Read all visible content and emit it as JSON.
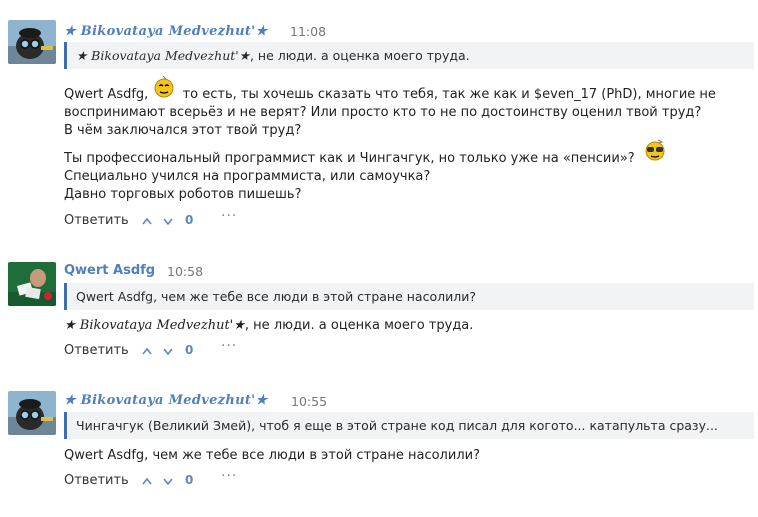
{
  "colors": {
    "author": "#4f7fbf",
    "quote_bar": "#3f6fa8",
    "quote_bg": "#f2f3f5",
    "vote": "#5b86c5"
  },
  "comments": [
    {
      "author": "★ Bikovataya Medvezhut'★",
      "time": "11:08",
      "quote_name": "★ Bikovataya Medvezhut'★",
      "quote_text": ", не люди. а оценка моего труда.",
      "p1_name": "Qwert Asdfg,",
      "p1_l1": "то есть, ты хочешь сказать что тебя, так же как и $even_17 (PhD), многие не",
      "p1_l2": "воспринимают всерьёз и не верят? Или просто кто то не по достоинству оценил твой труд?",
      "p1_l3": "В чём заключался этот твой труд?",
      "p2_l1": "Ты профессиональный программист как и Чингачгук, но только уже на «пенсии»?",
      "p2_l2": "Специально учился на программиста, или самоучка?",
      "p2_l3": "Давно торговых роботов пишешь?",
      "reply": "Ответить",
      "votes": "0",
      "more": "···"
    },
    {
      "author": "Qwert Asdfg",
      "time": "10:58",
      "quote_text": "Qwert Asdfg, чем же тебе все люди в этой стране насолили?",
      "body_name": "★ Bikovataya Medvezhut'★",
      "body_text": ", не люди. а оценка моего труда.",
      "reply": "Ответить",
      "votes": "0",
      "more": "···"
    },
    {
      "author": "★ Bikovataya Medvezhut'★",
      "time": "10:55",
      "quote_text": "Чингачгук (Великий Змей), чтоб я еще в этой стране код писал для когото... катапульта сразу...",
      "body_text": "Qwert Asdfg, чем же тебе все люди в этой стране насолили?",
      "reply": "Ответить",
      "votes": "0",
      "more": "···"
    }
  ]
}
